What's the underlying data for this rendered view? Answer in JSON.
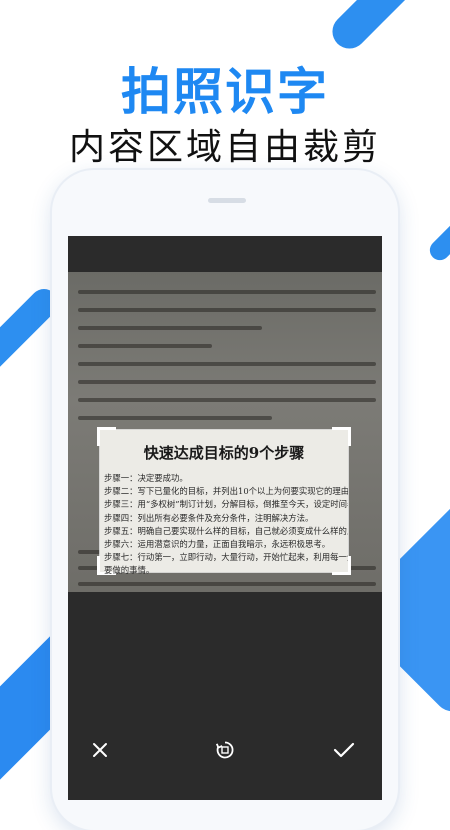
{
  "hero": {
    "title": "拍照识字",
    "subtitle": "内容区域自由裁剪"
  },
  "colors": {
    "accent": "#1e88f2",
    "screen_bg": "#2b2b2b"
  },
  "document": {
    "crop_title": "快速达成目标的9个步骤",
    "steps": [
      "步骤一：决定要成功。",
      "步骤二：写下已量化的目标，并列出10个以上为何要实现它的理由。",
      "步骤三：用“多权树”制订计划，分解目标，倒推至今天，设定时间表。",
      "步骤四：列出所有必要条件及充分条件，注明解决方法。",
      "步骤五：明确自己要实现什么样的目标，自己就必须变成什么样的人！",
      "步骤六：运用潜意识的力量，正面自我暗示，永远积极思考。",
      "步骤七：行动第一，立即行动，大量行动，开始忙起来，利用每一分、每一秒来做",
      "要做的事情。"
    ]
  },
  "toolbar": {
    "cancel_icon": "close-icon",
    "rotate_icon": "rotate-icon",
    "confirm_icon": "check-icon"
  }
}
